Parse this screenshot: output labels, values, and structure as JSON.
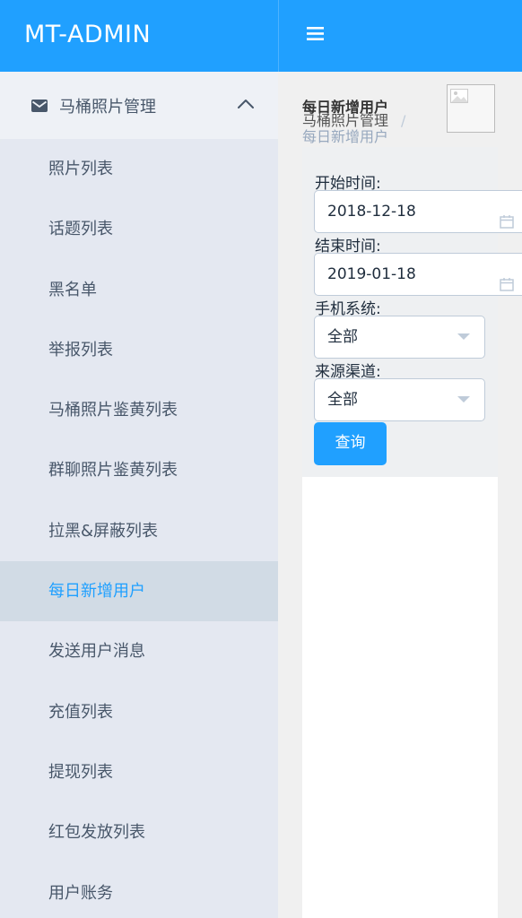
{
  "app": {
    "brand": "MT-ADMIN"
  },
  "sidebar": {
    "group_label": "马桶照片管理",
    "items": [
      {
        "label": "照片列表"
      },
      {
        "label": "话题列表"
      },
      {
        "label": "黑名单"
      },
      {
        "label": "举报列表"
      },
      {
        "label": "马桶照片鉴黄列表"
      },
      {
        "label": "群聊照片鉴黄列表"
      },
      {
        "label": "拉黑&屏蔽列表"
      },
      {
        "label": "每日新增用户",
        "active": true
      },
      {
        "label": "发送用户消息"
      },
      {
        "label": "充值列表"
      },
      {
        "label": "提现列表"
      },
      {
        "label": "红包发放列表"
      },
      {
        "label": "用户账务"
      }
    ]
  },
  "header": {
    "title": "每日新增用户",
    "breadcrumb": [
      "马桶照片管理",
      "每日新增用户"
    ],
    "breadcrumb_separator": "/"
  },
  "form": {
    "start_label": "开始时间:",
    "start_value": "2018-12-18",
    "end_label": "结束时间:",
    "end_value": "2019-01-18",
    "os_label": "手机系统:",
    "os_value": "全部",
    "channel_label": "来源渠道:",
    "channel_value": "全部",
    "query_button": "查询"
  },
  "colors": {
    "accent": "#20a0ff",
    "sidebar_bg": "#e4e9ef",
    "active_bg": "#d1dbe5"
  },
  "icons": {
    "menu": "hamburger-icon",
    "group": "mail-icon",
    "collapse": "chevron-up-icon",
    "date": "calendar-icon",
    "select": "caret-down-icon"
  }
}
